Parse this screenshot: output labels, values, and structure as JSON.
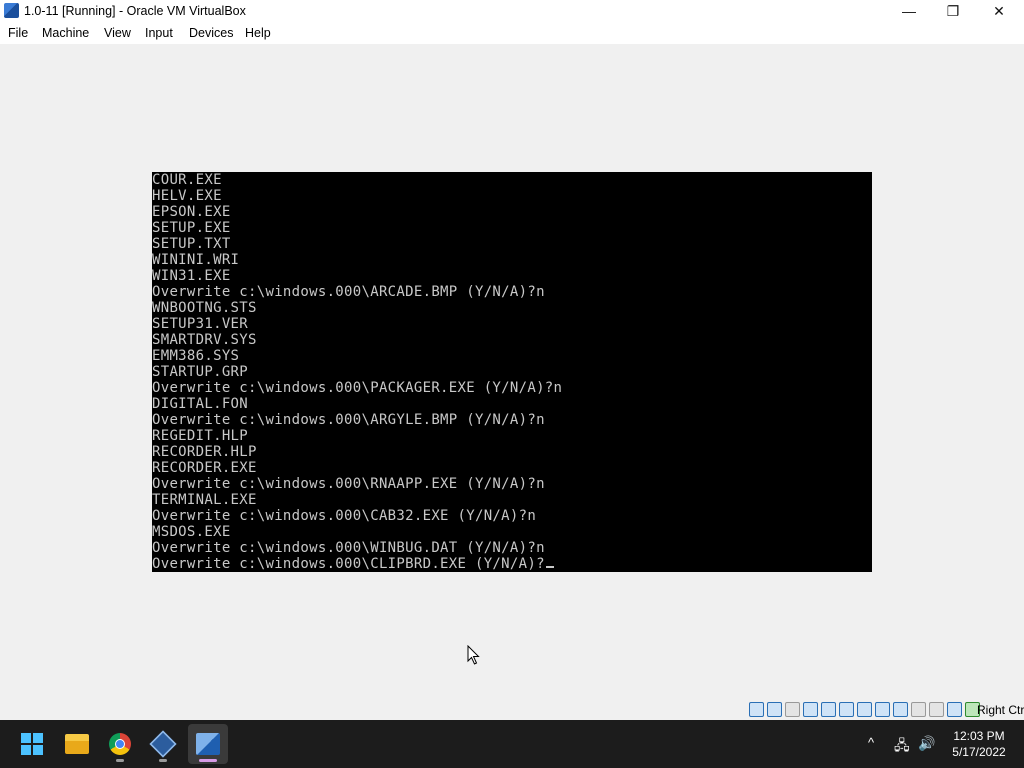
{
  "window": {
    "title": "1.0-11 [Running] - Oracle VM VirtualBox",
    "icon": "virtualbox-icon",
    "controls": {
      "minimize": "—",
      "restore": "❐",
      "close": "✕"
    }
  },
  "menubar": {
    "items": [
      "File",
      "Machine",
      "View",
      "Input",
      "Devices",
      "Help"
    ]
  },
  "console": {
    "lines": [
      "COUR.EXE",
      "HELV.EXE",
      "EPSON.EXE",
      "SETUP.EXE",
      "SETUP.TXT",
      "WININI.WRI",
      "WIN31.EXE",
      "Overwrite c:\\windows.000\\ARCADE.BMP (Y/N/A)?n",
      "WNBOOTNG.STS",
      "SETUP31.VER",
      "SMARTDRV.SYS",
      "EMM386.SYS",
      "STARTUP.GRP",
      "Overwrite c:\\windows.000\\PACKAGER.EXE (Y/N/A)?n",
      "DIGITAL.FON",
      "Overwrite c:\\windows.000\\ARGYLE.BMP (Y/N/A)?n",
      "REGEDIT.HLP",
      "RECORDER.HLP",
      "RECORDER.EXE",
      "Overwrite c:\\windows.000\\RNAAPP.EXE (Y/N/A)?n",
      "TERMINAL.EXE",
      "Overwrite c:\\windows.000\\CAB32.EXE (Y/N/A)?n",
      "MSDOS.EXE",
      "Overwrite c:\\windows.000\\WINBUG.DAT (Y/N/A)?n",
      "Overwrite c:\\windows.000\\CLIPBRD.EXE (Y/N/A)?"
    ]
  },
  "statusbar": {
    "icons": [
      "hard-disk-icon",
      "optical-drive-icon",
      "floppy-icon",
      "audio-icon",
      "network-icon",
      "usb-icon",
      "shared-folders-icon",
      "display-icon",
      "video-capture-icon",
      "recording-icon",
      "cpu-icon",
      "mouse-integration-icon",
      "host-key-icon"
    ],
    "host_key_label": "Right Ctrl"
  },
  "taskbar": {
    "apps": [
      "start-menu",
      "file-explorer",
      "google-chrome",
      "virtualbox-manager",
      "virtualbox-vm"
    ],
    "active_app": "virtualbox-vm",
    "tray": {
      "chevron": "^",
      "network": "🖧",
      "volume": "🔊"
    },
    "clock": {
      "time": "12:03 PM",
      "date": "5/17/2022"
    }
  }
}
